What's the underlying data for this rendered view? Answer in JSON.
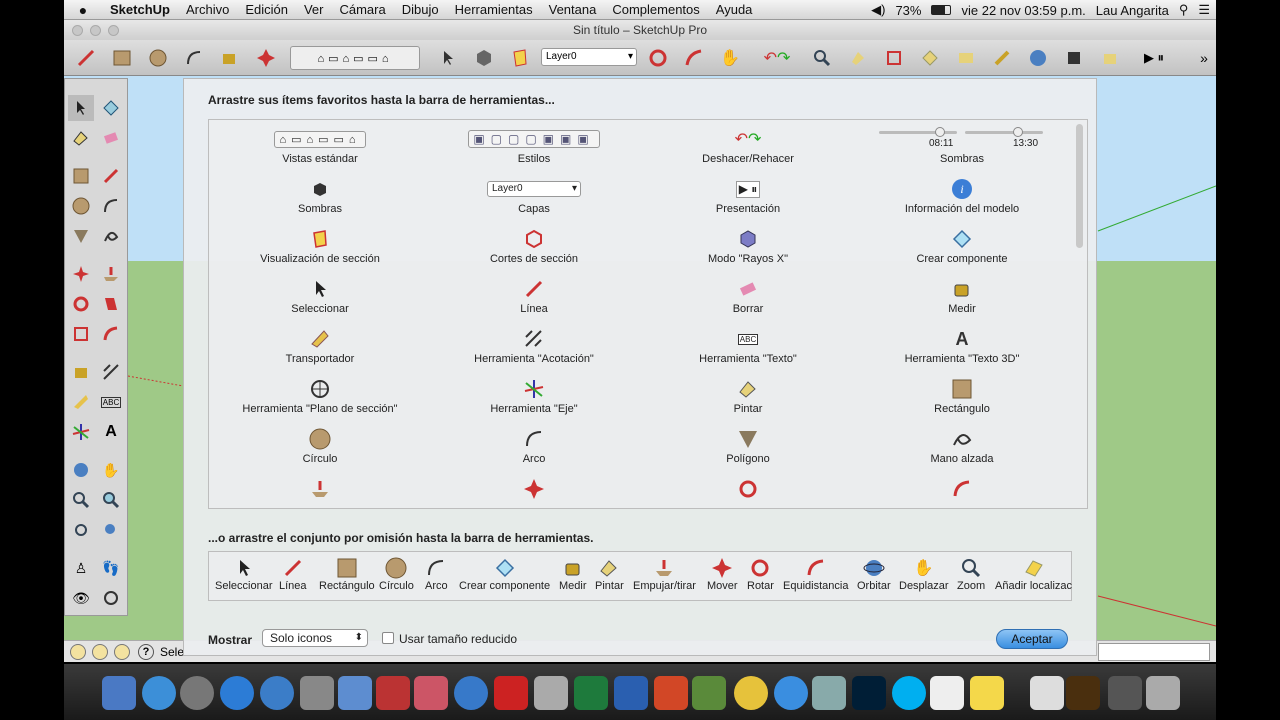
{
  "menubar": {
    "app": "SketchUp",
    "menus": [
      "Archivo",
      "Edición",
      "Ver",
      "Cámara",
      "Dibujo",
      "Herramientas",
      "Ventana",
      "Complementos",
      "Ayuda"
    ],
    "battery": "73%",
    "clock": "vie 22 nov  03:59 p.m.",
    "user": "Lau Angarita"
  },
  "window": {
    "title": "Sin título – SketchUp Pro"
  },
  "toolbar": {
    "layer_select": "Layer0"
  },
  "dialog": {
    "favorites_heading": "Arrastre sus ítems favoritos hasta la barra de herramientas...",
    "items": [
      {
        "label": "Vistas estándar",
        "icon": "standard-views-icon"
      },
      {
        "label": "Estilos",
        "icon": "styles-icon"
      },
      {
        "label": "Deshacer/Rehacer",
        "icon": "undo-redo-icon"
      },
      {
        "label": "Sombras",
        "icon": "shadow-sliders-icon",
        "time_a": "08:11",
        "time_b": "13:30"
      },
      {
        "label": "Sombras",
        "icon": "shadows-icon"
      },
      {
        "label": "Capas",
        "icon": "layers-select",
        "value": "Layer0"
      },
      {
        "label": "Presentación",
        "icon": "presentation-icon"
      },
      {
        "label": "Información del modelo",
        "icon": "info-icon"
      },
      {
        "label": "Visualización de sección",
        "icon": "section-display-icon"
      },
      {
        "label": "Cortes de sección",
        "icon": "section-cuts-icon"
      },
      {
        "label": "Modo \"Rayos X\"",
        "icon": "xray-icon"
      },
      {
        "label": "Crear componente",
        "icon": "component-icon"
      },
      {
        "label": "Seleccionar",
        "icon": "select-icon"
      },
      {
        "label": "Línea",
        "icon": "pencil-icon"
      },
      {
        "label": "Borrar",
        "icon": "eraser-icon"
      },
      {
        "label": "Medir",
        "icon": "tape-icon"
      },
      {
        "label": "Transportador",
        "icon": "protractor-icon"
      },
      {
        "label": "Herramienta \"Acotación\"",
        "icon": "dimension-icon"
      },
      {
        "label": "Herramienta \"Texto\"",
        "icon": "text-icon"
      },
      {
        "label": "Herramienta \"Texto 3D\"",
        "icon": "text3d-icon"
      },
      {
        "label": "Herramienta \"Plano de sección\"",
        "icon": "section-plane-icon"
      },
      {
        "label": "Herramienta \"Eje\"",
        "icon": "axes-icon"
      },
      {
        "label": "Pintar",
        "icon": "paint-icon"
      },
      {
        "label": "Rectángulo",
        "icon": "rectangle-icon"
      },
      {
        "label": "Círculo",
        "icon": "circle-icon"
      },
      {
        "label": "Arco",
        "icon": "arc-icon"
      },
      {
        "label": "Polígono",
        "icon": "polygon-icon"
      },
      {
        "label": "Mano alzada",
        "icon": "freehand-icon"
      }
    ],
    "default_heading": "...o arrastre el conjunto por omisión hasta la barra de herramientas.",
    "default_set": [
      "Seleccionar",
      "Línea",
      "Rectángulo",
      "Círculo",
      "Arco",
      "Crear componente",
      "Medir",
      "Pintar",
      "Empujar/tirar",
      "Mover",
      "Rotar",
      "Equidistancia",
      "Orbitar",
      "Desplazar",
      "Zoom",
      "Añadir localizac"
    ],
    "show_label": "Mostrar",
    "show_value": "Solo iconos",
    "small_size_label": "Usar tamaño reducido",
    "accept_label": "Aceptar"
  },
  "statusbar": {
    "text": "Sele"
  },
  "colors": {
    "accent": "#3a8ee0",
    "sky": "#bfe0f7",
    "ground": "#9fc987"
  }
}
